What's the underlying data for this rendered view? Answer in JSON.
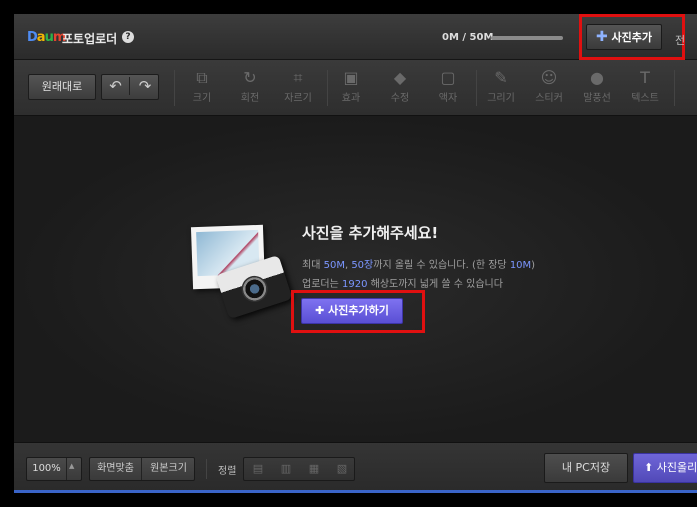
{
  "titlebar": {
    "logo": {
      "d": "D",
      "a": "a",
      "u": "u",
      "m": "m"
    },
    "title": "포토업로더",
    "help": "?",
    "capacity": "0M / 50M",
    "capacity_progress": 0,
    "add_photo_label": "사진추가",
    "cut_label": "전"
  },
  "toolbar": {
    "original_label": "원래대로",
    "undo_icon": "undo-icon",
    "redo_icon": "redo-icon",
    "tools": [
      {
        "label": "크기",
        "icon": "resize-icon"
      },
      {
        "label": "회전",
        "icon": "rotate-icon"
      },
      {
        "label": "자르기",
        "icon": "crop-icon"
      },
      {
        "label": "효과",
        "icon": "effect-icon"
      },
      {
        "label": "수정",
        "icon": "eraser-icon"
      },
      {
        "label": "액자",
        "icon": "frame-icon"
      },
      {
        "label": "그리기",
        "icon": "brush-icon"
      },
      {
        "label": "스티커",
        "icon": "sticker-icon"
      },
      {
        "label": "말풍선",
        "icon": "speech-bubble-icon"
      },
      {
        "label": "텍스트",
        "icon": "text-icon"
      }
    ]
  },
  "canvas": {
    "title": "사진을 추가해주세요!",
    "line1": {
      "prefix": "최대 ",
      "hl1": "50M",
      "sep": ", ",
      "hl2": "50장",
      "mid": "까지 올릴 수 있습니다. (한 장당 ",
      "hl3": "10M",
      "suffix": ")"
    },
    "line2": {
      "prefix": "업로더는 ",
      "hl": "1920",
      "suffix": " 해상도까지 넓게 쓸 수 있습니다"
    },
    "add_button_label": "사진추가하기"
  },
  "bottombar": {
    "zoom": "100%",
    "fit_screen": "화면맞춤",
    "original_size": "원본크기",
    "align_label": "정렬",
    "save_pc": "내 PC저장",
    "upload": "사진올리기"
  },
  "colors": {
    "accent": "#6f66d8",
    "highlight": "#e01010",
    "link": "#7b96ff"
  }
}
